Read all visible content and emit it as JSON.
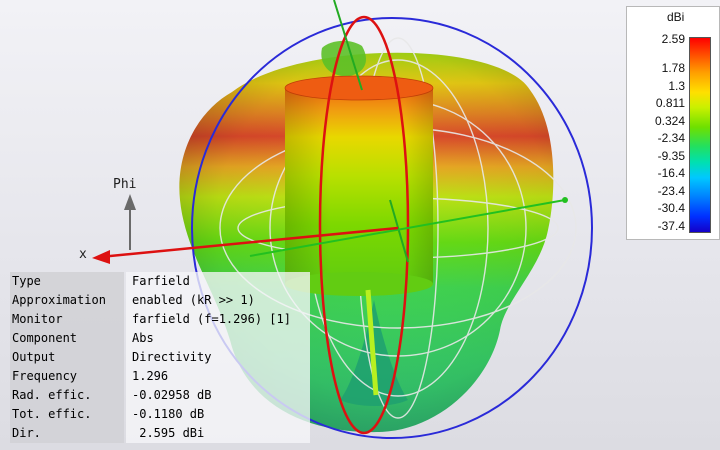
{
  "axis_labels": {
    "phi": "Phi",
    "x": "x"
  },
  "colorbar": {
    "unit": "dBi",
    "ticks": [
      "2.59",
      "1.78",
      "1.3",
      "0.811",
      "0.324",
      "-2.34",
      "-9.35",
      "-16.4",
      "-23.4",
      "-30.4",
      "-37.4"
    ]
  },
  "info": [
    {
      "key": "Type",
      "value": "Farfield"
    },
    {
      "key": "Approximation",
      "value": "enabled (kR >> 1)"
    },
    {
      "key": "Monitor",
      "value": "farfield (f=1.296) [1]"
    },
    {
      "key": "Component",
      "value": "Abs"
    },
    {
      "key": "Output",
      "value": "Directivity"
    },
    {
      "key": "Frequency",
      "value": "1.296"
    },
    {
      "key": "Rad. effic.",
      "value": "-0.02958 dB"
    },
    {
      "key": "Tot. effic.",
      "value": "-0.1180 dB"
    },
    {
      "key": "Dir.",
      "value": " 2.595 dBi"
    }
  ],
  "colors": {
    "theta_circle": "#dd1111",
    "phi_circle": "#2a2ad8",
    "z_axis": "#22aa22",
    "x_axis": "#dd1111"
  }
}
